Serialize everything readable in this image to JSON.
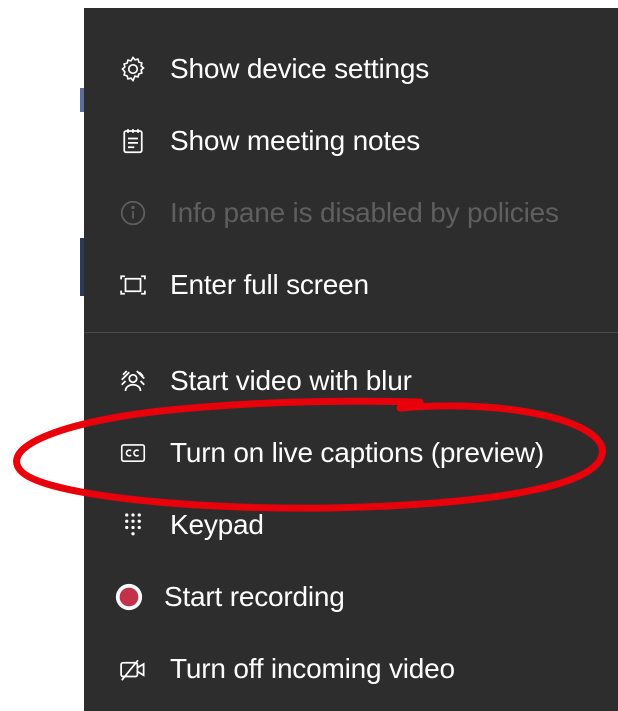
{
  "menu": {
    "items": [
      {
        "label": "Show device settings",
        "icon": "gear-icon",
        "disabled": false
      },
      {
        "label": "Show meeting notes",
        "icon": "notes-icon",
        "disabled": false
      },
      {
        "label": "Info pane is disabled by policies",
        "icon": "info-icon",
        "disabled": true
      },
      {
        "label": "Enter full screen",
        "icon": "fullscreen-icon",
        "disabled": false
      },
      {
        "label": "Start video with blur",
        "icon": "blur-background-icon",
        "disabled": false
      },
      {
        "label": "Turn on live captions (preview)",
        "icon": "closed-captions-icon",
        "disabled": false
      },
      {
        "label": "Keypad",
        "icon": "keypad-icon",
        "disabled": false
      },
      {
        "label": "Start recording",
        "icon": "record-icon",
        "disabled": false
      },
      {
        "label": "Turn off incoming video",
        "icon": "video-off-icon",
        "disabled": false
      }
    ]
  },
  "colors": {
    "menu_background": "#2d2d2d",
    "text": "#ffffff",
    "disabled_text": "#5f5f5f",
    "record": "#c4314b",
    "annotation": "#e8000b"
  }
}
